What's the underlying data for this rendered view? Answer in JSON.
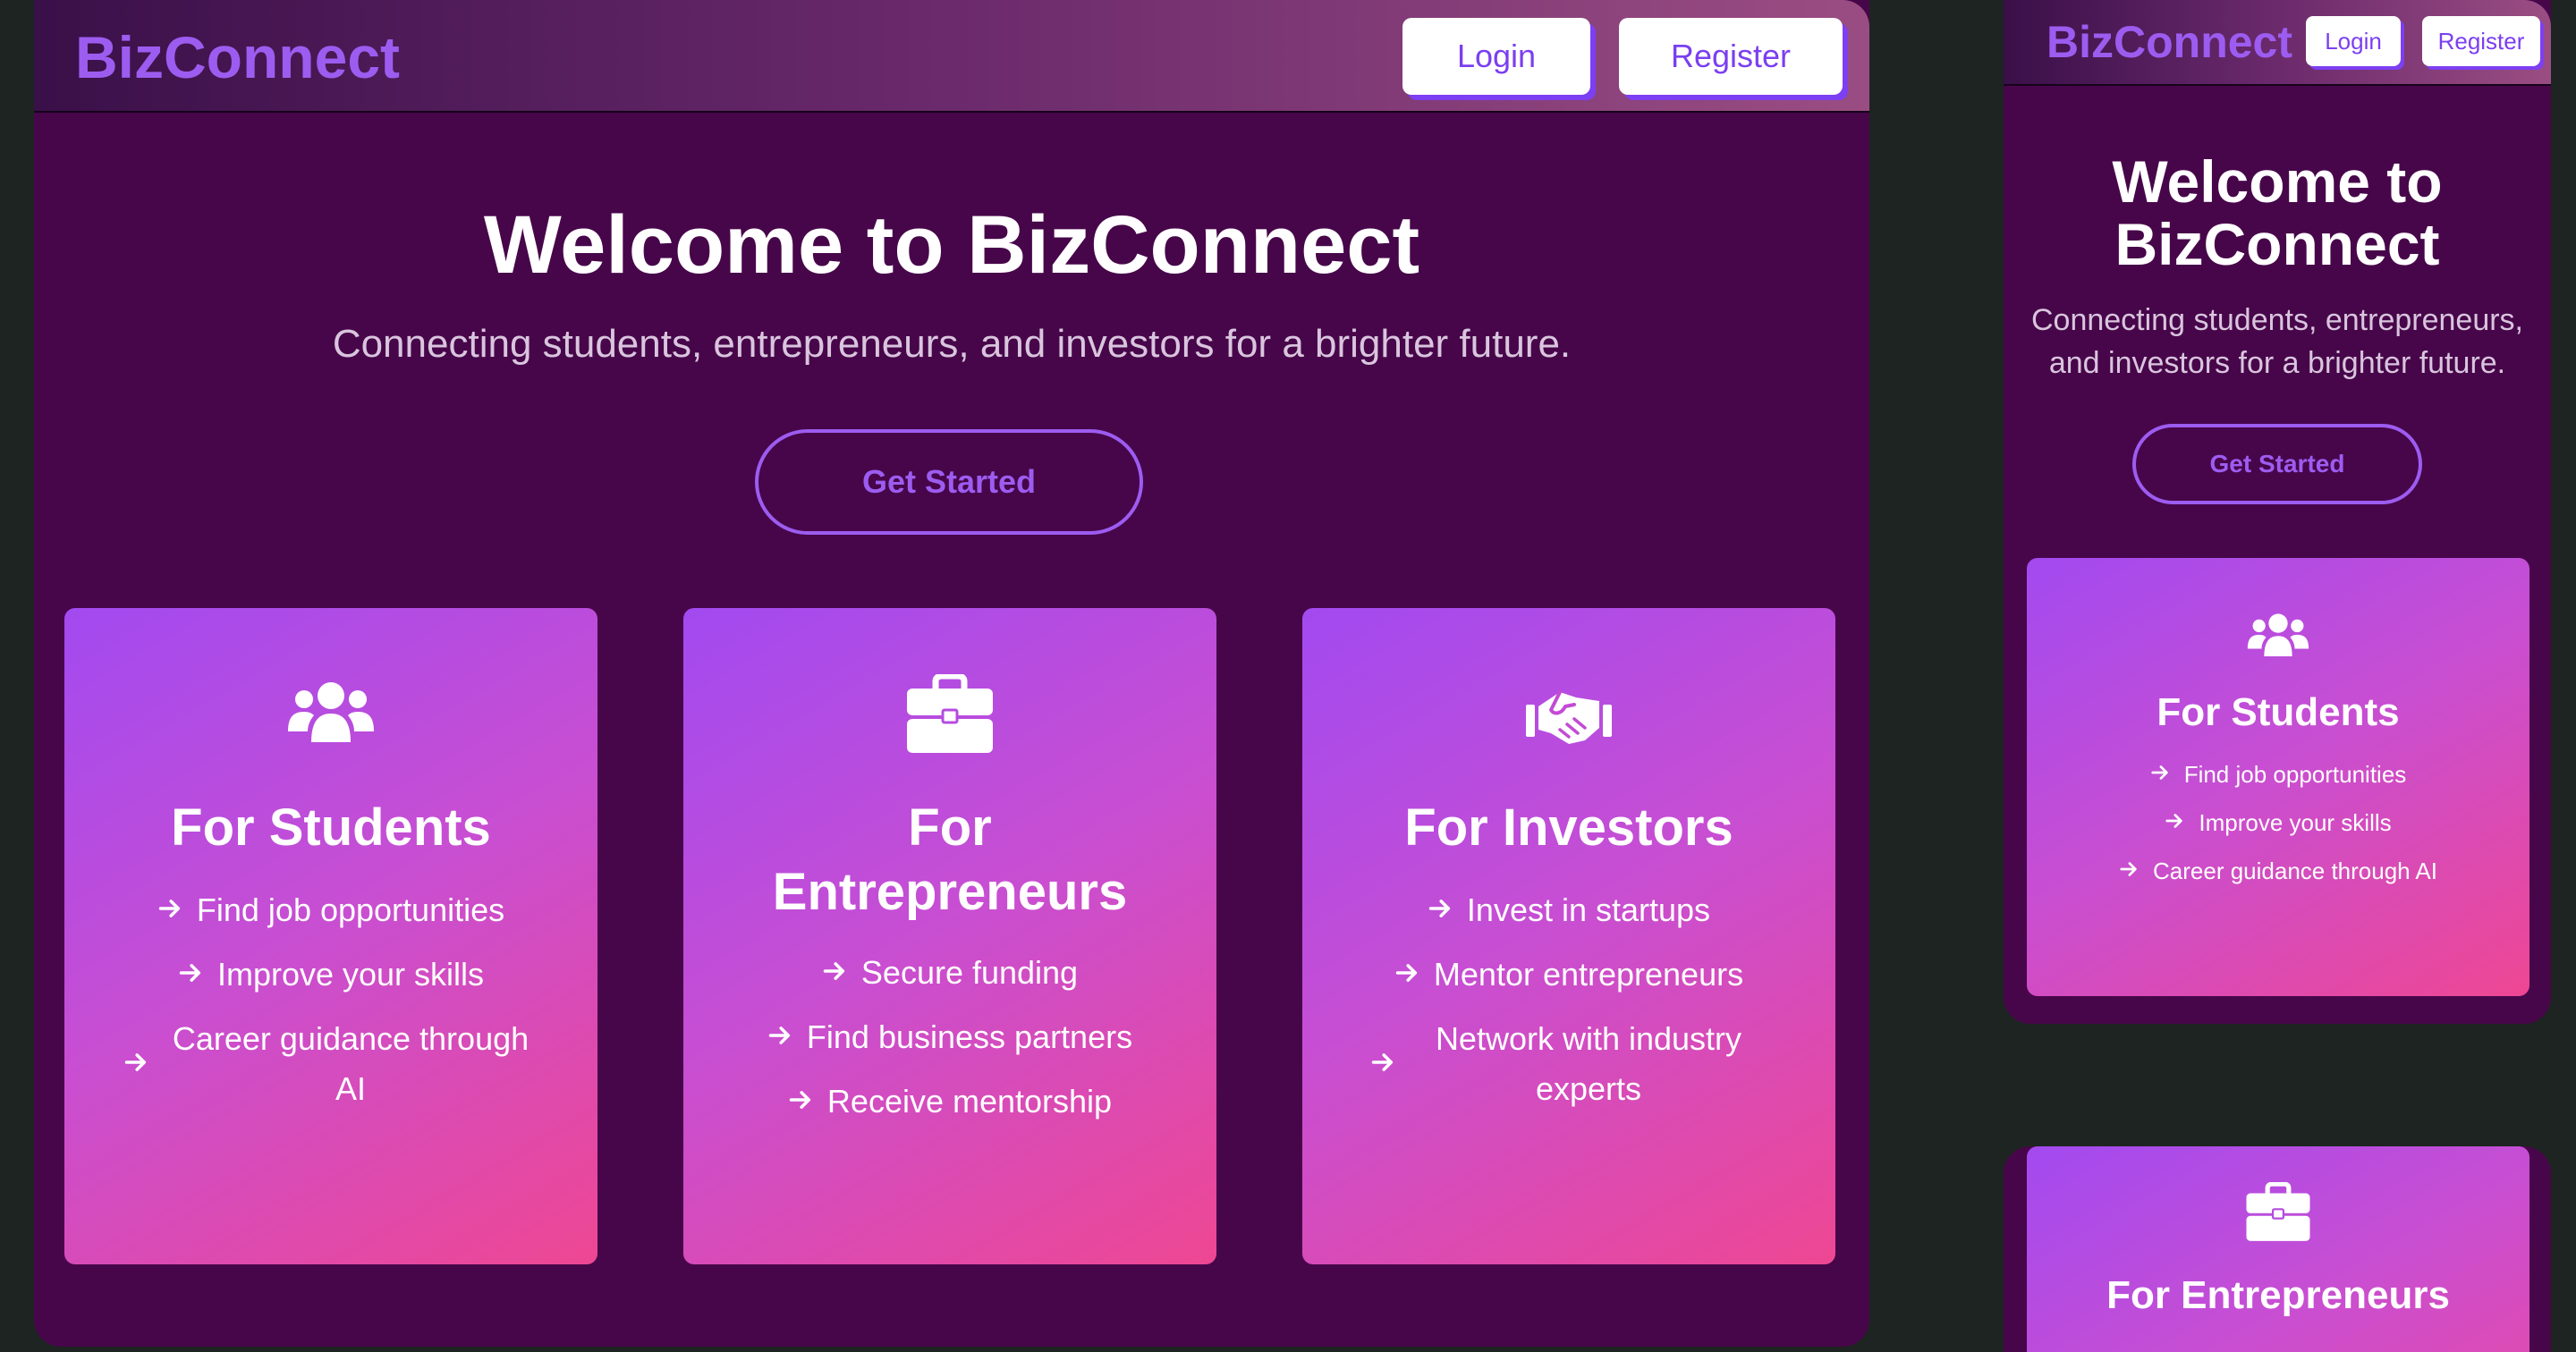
{
  "brand": "BizConnect",
  "header": {
    "login_label": "Login",
    "register_label": "Register"
  },
  "hero": {
    "title": "Welcome to BizConnect",
    "subtitle": "Connecting students, entrepreneurs, and investors for a brighter future.",
    "cta_label": "Get Started"
  },
  "cards": [
    {
      "icon": "users-icon",
      "title": "For Students",
      "items": [
        "Find job opportunities",
        "Improve your skills",
        "Career guidance through AI"
      ]
    },
    {
      "icon": "briefcase-icon",
      "title": "For Entrepreneurs",
      "items": [
        "Secure funding",
        "Find business partners",
        "Receive mentorship"
      ]
    },
    {
      "icon": "handshake-icon",
      "title": "For Investors",
      "items": [
        "Invest in startups",
        "Mentor entrepreneurs",
        "Network with industry experts"
      ]
    }
  ],
  "colors": {
    "page_background": "#1e2421",
    "frame_background": "#47064a",
    "accent_purple": "#9d5cf0",
    "card_gradient_start": "#a24af0",
    "card_gradient_end": "#ee4793",
    "button_background": "#ffffff"
  }
}
